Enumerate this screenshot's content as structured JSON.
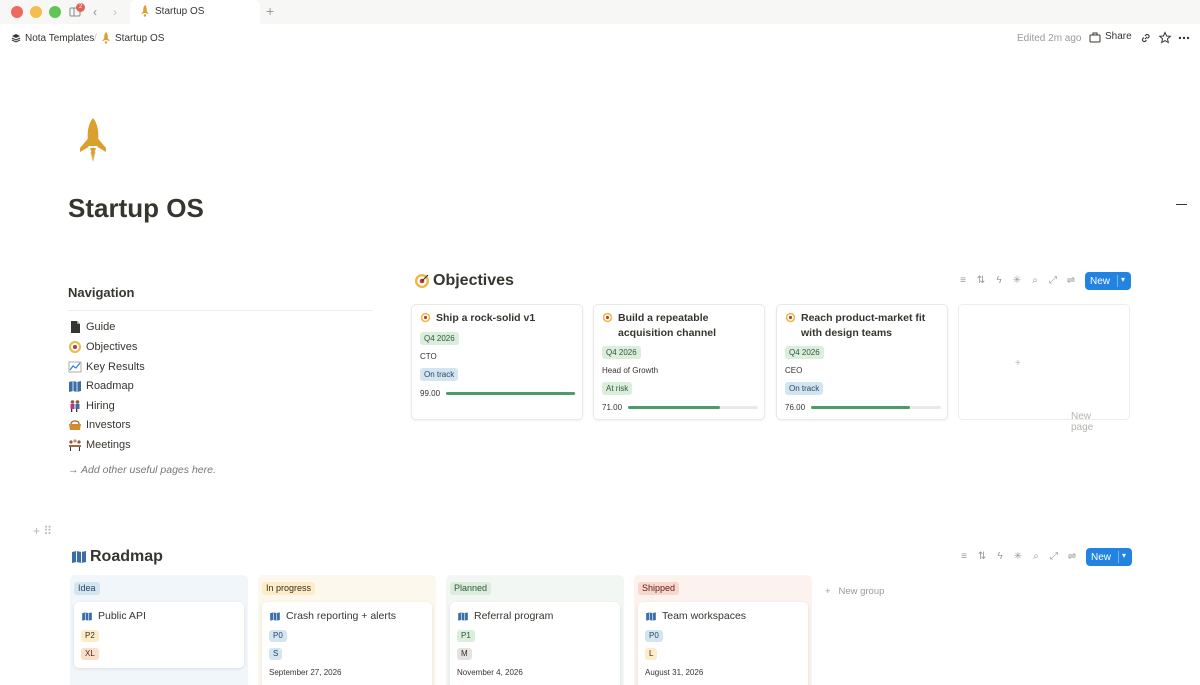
{
  "tab": {
    "title": "Startup OS",
    "badge_count": "2"
  },
  "breadcrumb": {
    "workspace": "Nota Templates",
    "page": "Startup OS"
  },
  "topbar": {
    "edited": "Edited 2m ago",
    "share_label": "Share"
  },
  "page": {
    "title": "Startup OS"
  },
  "navigation": {
    "heading": "Navigation",
    "items": [
      {
        "label": "Guide",
        "icon": "document-icon"
      },
      {
        "label": "Objectives",
        "icon": "target-icon"
      },
      {
        "label": "Key Results",
        "icon": "chart-icon"
      },
      {
        "label": "Roadmap",
        "icon": "map-icon"
      },
      {
        "label": "Hiring",
        "icon": "people-icon"
      },
      {
        "label": "Investors",
        "icon": "bag-icon"
      },
      {
        "label": "Meetings",
        "icon": "meeting-icon"
      }
    ],
    "hint": "→ Add other useful pages here."
  },
  "objectives": {
    "title": "Objectives",
    "new_label": "New",
    "new_page_label": "New page",
    "cards": [
      {
        "title": "Ship a rock-solid v1",
        "quarter": "Q4 2026",
        "owner": "CTO",
        "status": "On track",
        "progress_text": "99.00",
        "progress": 0.99
      },
      {
        "title": "Build a repeatable acquisition channel",
        "quarter": "Q4 2026",
        "owner": "Head of Growth",
        "status": "At risk",
        "progress_text": "71.00",
        "progress": 0.71
      },
      {
        "title": "Reach product-market fit with design teams",
        "quarter": "Q4 2026",
        "owner": "CEO",
        "status": "On track",
        "progress_text": "76.00",
        "progress": 0.76
      }
    ]
  },
  "roadmap": {
    "title": "Roadmap",
    "new_label": "New",
    "new_group_label": "New group",
    "columns": [
      {
        "label": "Idea",
        "card": {
          "title": "Public API",
          "priority": "P2",
          "size": "XL",
          "date": ""
        }
      },
      {
        "label": "In progress",
        "card": {
          "title": "Crash reporting + alerts",
          "priority": "P0",
          "size": "S",
          "date": "September 27, 2026"
        }
      },
      {
        "label": "Planned",
        "card": {
          "title": "Referral program",
          "priority": "P1",
          "size": "M",
          "date": "November 4, 2026"
        }
      },
      {
        "label": "Shipped",
        "card": {
          "title": "Team workspaces",
          "priority": "P0",
          "size": "L",
          "date": "August 31, 2026"
        }
      }
    ]
  },
  "colors": {
    "accent": "#2383e2",
    "rocket": "#d9a02e",
    "progress": "#4d9a6a"
  }
}
